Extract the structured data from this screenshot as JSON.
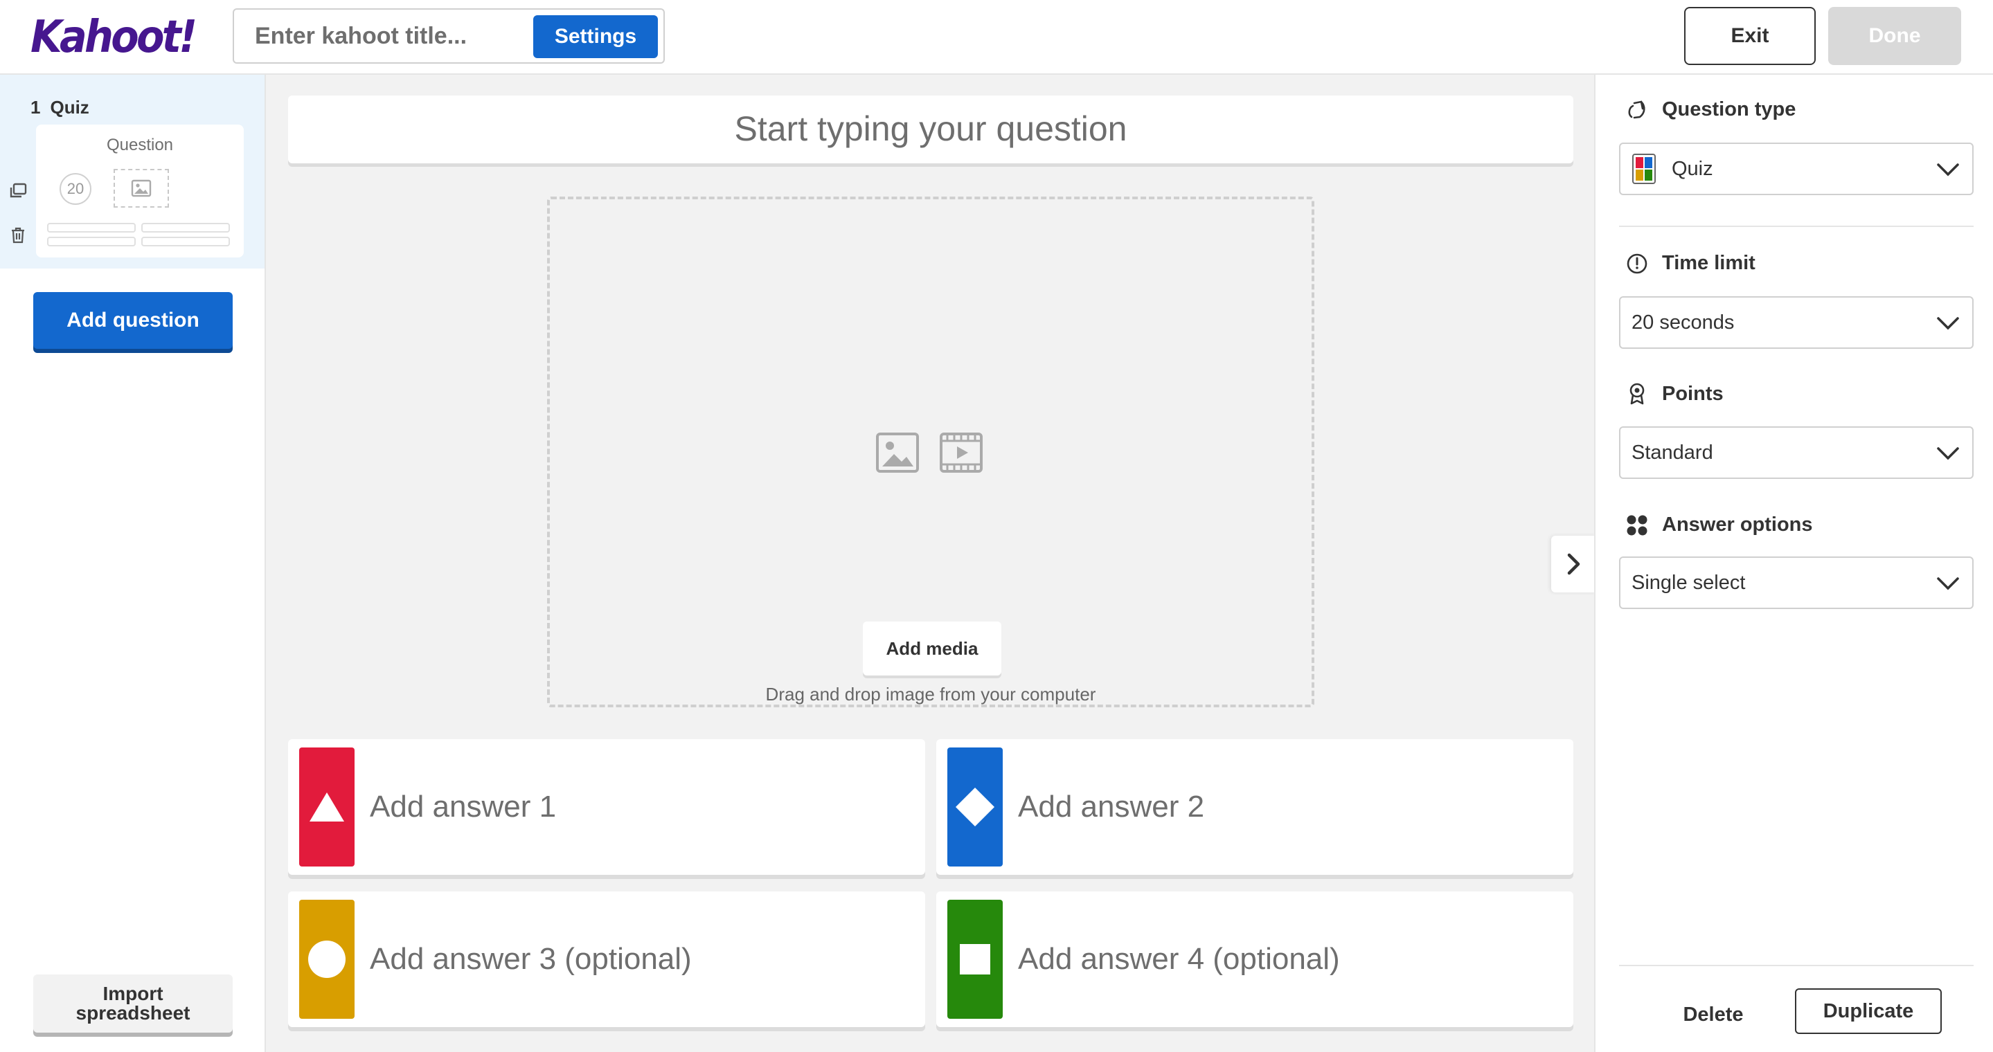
{
  "header": {
    "logo": "Kahoot!",
    "title_placeholder": "Enter kahoot title...",
    "settings_label": "Settings",
    "exit_label": "Exit",
    "done_label": "Done"
  },
  "sidebar": {
    "slide": {
      "number": "1",
      "type": "Quiz",
      "thumb_question": "Question",
      "thumb_time": "20"
    },
    "add_question_label": "Add question",
    "import_label_line1": "Import",
    "import_label_line2": "spreadsheet"
  },
  "editor": {
    "question_placeholder": "Start typing your question",
    "add_media_label": "Add media",
    "drag_text": "Drag and drop image from your computer",
    "answers": [
      {
        "placeholder": "Add answer 1",
        "color": "#e21b3c",
        "shape": "triangle"
      },
      {
        "placeholder": "Add answer 2",
        "color": "#1368ce",
        "shape": "diamond"
      },
      {
        "placeholder": "Add answer 3 (optional)",
        "color": "#d89e00",
        "shape": "circle"
      },
      {
        "placeholder": "Add answer 4 (optional)",
        "color": "#26890c",
        "shape": "square"
      }
    ]
  },
  "settings_panel": {
    "question_type": {
      "label": "Question type",
      "value": "Quiz"
    },
    "time_limit": {
      "label": "Time limit",
      "value": "20 seconds"
    },
    "points": {
      "label": "Points",
      "value": "Standard"
    },
    "answer_options": {
      "label": "Answer options",
      "value": "Single select"
    },
    "delete_label": "Delete",
    "duplicate_label": "Duplicate"
  },
  "colors": {
    "brand": "#46178f",
    "primary": "#1368ce"
  }
}
